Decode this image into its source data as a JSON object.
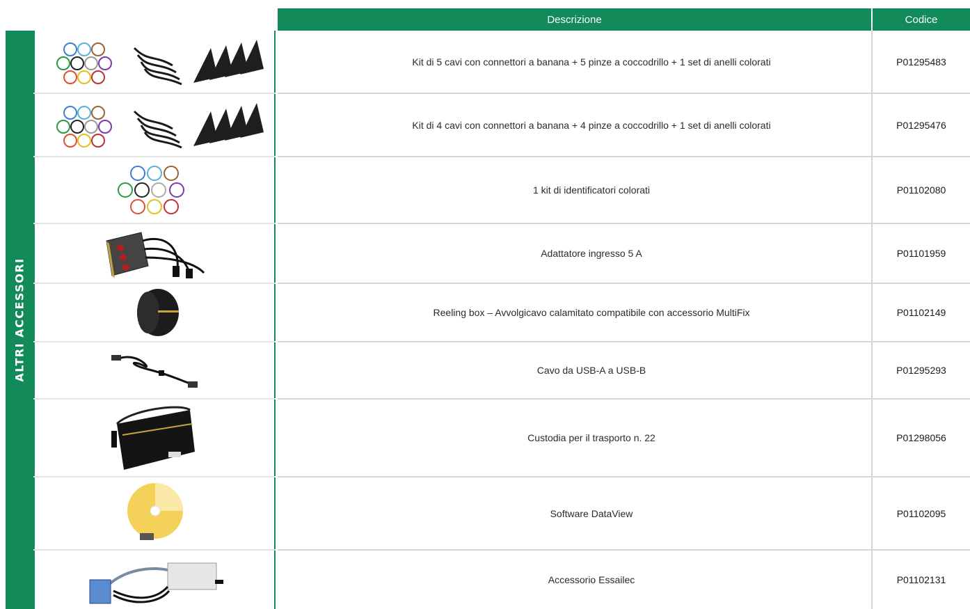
{
  "header": {
    "description_label": "Descrizione",
    "code_label": "Codice"
  },
  "sidebar": {
    "label": "ALTRI ACCESSORI"
  },
  "rows": [
    {
      "description": "Kit di 5 cavi con connettori a banana + 5 pinze a coccodrillo + 1 set di anelli colorati",
      "code": "P01295483",
      "icon": "cables-clips-rings-kit-icon"
    },
    {
      "description": "Kit di 4 cavi con connettori a banana + 4 pinze a coccodrillo + 1 set di anelli colorati",
      "code": "P01295476",
      "icon": "cables-clips-rings-kit-icon"
    },
    {
      "description": "1 kit di identificatori colorati",
      "code": "P01102080",
      "icon": "colored-rings-icon"
    },
    {
      "description": "Adattatore ingresso 5 A",
      "code": "P01101959",
      "icon": "adapter-box-icon"
    },
    {
      "description": "Reeling box – Avvolgicavo calamitato compatibile con accessorio MultiFix",
      "code": "P01102149",
      "icon": "reeling-box-icon"
    },
    {
      "description": "Cavo da USB-A a USB-B",
      "code": "P01295293",
      "icon": "usb-cable-icon"
    },
    {
      "description": "Custodia per il trasporto n. 22",
      "code": "P01298056",
      "icon": "carrying-bag-icon"
    },
    {
      "description": "Software DataView",
      "code": "P01102095",
      "icon": "software-cd-icon"
    },
    {
      "description": "Accessorio Essailec",
      "code": "P01102131",
      "icon": "essailec-accessory-icon"
    }
  ],
  "colors": {
    "accent": "#138a5a",
    "separator": "#d6d6d6"
  }
}
